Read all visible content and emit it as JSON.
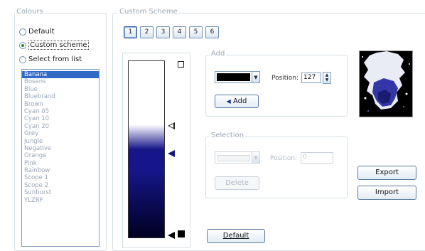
{
  "colours": {
    "title": "Colours",
    "options": [
      {
        "label": "Default",
        "selected": false
      },
      {
        "label": "Custom scheme",
        "selected": true
      },
      {
        "label": "Select from list",
        "selected": false
      }
    ],
    "list": [
      "Banana",
      "Bosens",
      "Blue",
      "Bluebrand",
      "Brown",
      "Cyan 05",
      "Cyan 10",
      "Cyan 20",
      "Grey",
      "Jungle",
      "Negative",
      "Orange",
      "Pink",
      "Rainbow",
      "Scope 1",
      "Scope 2",
      "Sunburst",
      "YLZRF"
    ],
    "list_selected_index": 0
  },
  "scheme": {
    "title": "Custom Scheme",
    "numbers": [
      "1",
      "2",
      "3",
      "4",
      "5",
      "6"
    ],
    "selected_number": 0,
    "add": {
      "title": "Add",
      "color": "#000000",
      "position_label": "Position:",
      "position_value": "127",
      "add_button": "Add"
    },
    "selection": {
      "title": "Selection",
      "position_label": "Position:",
      "position_value": "0",
      "delete_button": "Delete"
    },
    "default_button": "Default",
    "export_button": "Export",
    "import_button": "Import",
    "gradient_colors": {
      "top": "#ffffff",
      "mid": "#16168a",
      "bottom": "#000022"
    }
  }
}
